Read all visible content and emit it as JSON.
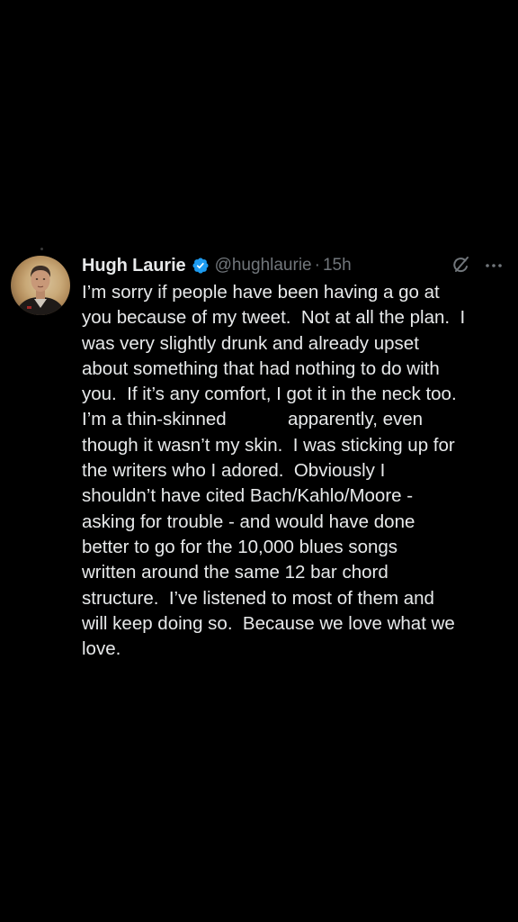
{
  "tweet": {
    "author_name": "Hugh Laurie",
    "handle": "@hughlaurie",
    "separator": "·",
    "time": "15h",
    "verified_icon": "verified-badge-icon",
    "grok_icon": "grok-icon",
    "more_icon": "more-options-icon",
    "lines": [
      "I’m sorry if people have been having a go at",
      "you because of my tweet.  Not at all the plan.  I",
      "was very slightly drunk and already upset",
      "about something that had nothing to do with",
      "you.  If it’s any comfort, I got it in the neck too.",
      "I’m a thin-skinned            apparently, even",
      "though it wasn’t my skin.  I was sticking up for",
      "the writers who I adored.  Obviously I",
      "shouldn’t have cited Bach/Kahlo/Moore -",
      "asking for trouble - and would have done",
      "better to go for the 10,000 blues songs",
      "written around the same 12 bar chord",
      "structure.  I’ve listened to most of them and",
      "will keep doing so.  Because we love what we",
      "love."
    ]
  },
  "colors": {
    "background": "#000000",
    "text": "#e7e9ea",
    "muted": "#71767b",
    "verified": "#1d9bf0"
  }
}
